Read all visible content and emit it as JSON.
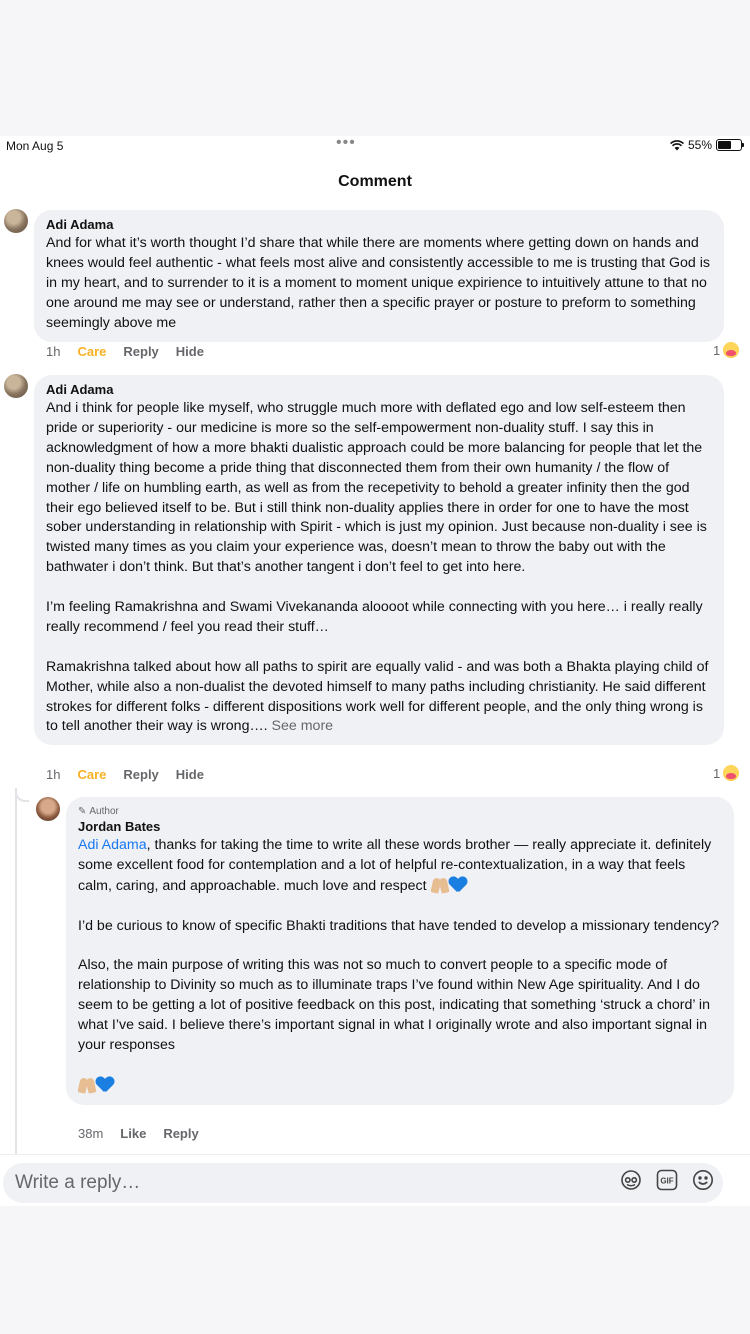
{
  "status_bar": {
    "time": "Mon Aug 5",
    "dots": "•••",
    "battery": "55%"
  },
  "page": {
    "title": "Comment"
  },
  "comments": [
    {
      "author": "Adi Adama",
      "paragraphs": [
        "And for what it’s worth thought I’d share that while there are moments where getting down on hands and knees would feel authentic - what feels most alive and consistently accessible to me is trusting that God is in my heart, and to surrender to it is a moment to moment unique expirience to intuitively attune to that no one around me may see or understand, rather then a specific prayer or posture to preform to something seemingly above me"
      ],
      "time": "1h",
      "reaction_label": "Care",
      "reply_label": "Reply",
      "hide_label": "Hide",
      "reaction_count": "1"
    },
    {
      "author": "Adi Adama",
      "paragraphs": [
        "And i think for people like myself, who struggle much more with deflated ego and low self-esteem then pride or superiority - our medicine is more so the self-empowerment non-duality stuff. I say this in acknowledgment of how a more bhakti dualistic approach could be more balancing for people that let the non-duality thing become a pride thing that disconnected them from their own humanity / the flow of mother / life on humbling earth, as well as from the recepetivity to behold a greater infinity then the god their ego believed itself to be. But i still think non-duality applies there in order for one to have the most sober understanding in relationship with Spirit - which is just my opinion. Just because non-duality i see is twisted many times as you claim your experience was, doesn’t mean to throw the baby out with the bathwater i don’t think. But that’s another tangent i don’t feel to get into here.",
        "I’m feeling Ramakrishna and Swami Vivekananda aloooot while connecting with you here… i really really really recommend / feel you read their stuff…",
        "Ramakrishna talked about how all paths to spirit are equally valid - and was both a Bhakta playing child of Mother, while also a non-dualist the devoted himself to many paths including christianity. He said different strokes for different folks - different dispositions work well for different people, and the only thing wrong is to tell another their way is wrong…."
      ],
      "see_more": "See more",
      "time": "1h",
      "reaction_label": "Care",
      "reply_label": "Reply",
      "hide_label": "Hide",
      "reaction_count": "1"
    }
  ],
  "author_reply": {
    "badge": "Author",
    "author": "Jordan Bates",
    "mention": "Adi Adama",
    "p1_text": ", thanks for taking the time to write all these words brother — really appreciate it. definitely some excellent food for contemplation and a lot of helpful re-contextualization, in a way that feels calm, caring, and approachable. much love and respect",
    "p2": "I’d be curious to know of specific Bhakti traditions that have tended to develop a missionary tendency?",
    "p3": "Also, the main purpose of writing this was not so much to convert people to a specific mode of relationship to Divinity so much as to illuminate traps I’ve found within New Age spirituality. And I do seem to be getting a lot of positive feedback on this post, indicating that something ‘struck a chord’ in what I’ve said. I believe there’s important signal in what I originally wrote and also important signal in your responses",
    "time": "38m",
    "like_label": "Like",
    "reply_label": "Reply"
  },
  "reply_box": {
    "placeholder": "Write a reply…",
    "icons": [
      "avatar-sticker-icon",
      "gif-icon",
      "emoji-icon"
    ],
    "gif_label": "GIF"
  },
  "colors": {
    "care": "#f7b125",
    "mention": "#1877f2",
    "bubble": "#f0f1f5",
    "muted": "#65676b"
  }
}
